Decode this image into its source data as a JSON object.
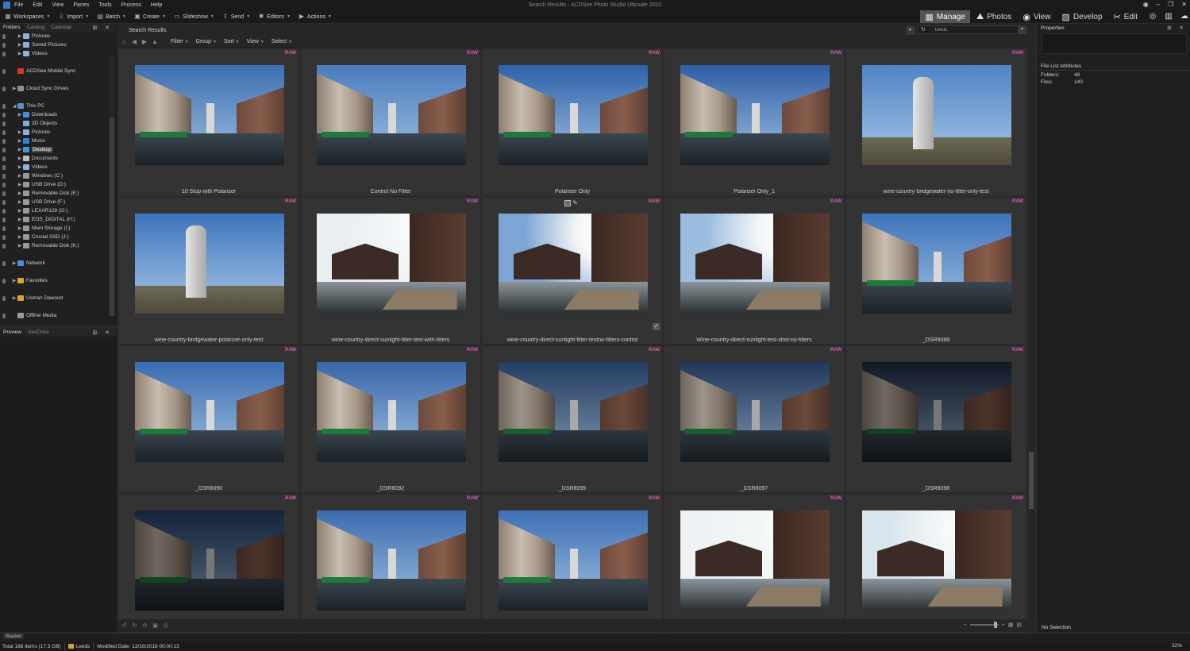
{
  "window": {
    "title": "Search Results - ACDSee Photo Studio Ultimate 2020"
  },
  "menu": [
    "File",
    "Edit",
    "View",
    "Panes",
    "Tools",
    "Process",
    "Help"
  ],
  "toolbar": [
    {
      "label": "Workspaces",
      "icon": "workspaces-icon",
      "glyph": "▦"
    },
    {
      "label": "Import",
      "icon": "import-icon",
      "glyph": "⇩"
    },
    {
      "label": "Batch",
      "icon": "batch-icon",
      "glyph": "▤"
    },
    {
      "label": "Create",
      "icon": "create-icon",
      "glyph": "▣"
    },
    {
      "label": "Slideshow",
      "icon": "slideshow-icon",
      "glyph": "▭"
    },
    {
      "label": "Send",
      "icon": "send-icon",
      "glyph": "⇪"
    },
    {
      "label": "Editors",
      "icon": "editors-icon",
      "glyph": "✱"
    },
    {
      "label": "Actions",
      "icon": "actions-icon",
      "glyph": "▶"
    }
  ],
  "modes": [
    {
      "label": "Manage",
      "icon": "manage-icon",
      "glyph": "▦",
      "active": true
    },
    {
      "label": "Photos",
      "icon": "photos-icon",
      "glyph": "⛰",
      "active": false
    },
    {
      "label": "View",
      "icon": "view-eye-icon",
      "glyph": "◉",
      "active": false
    },
    {
      "label": "Develop",
      "icon": "develop-icon",
      "glyph": "▨",
      "active": false
    },
    {
      "label": "Edit",
      "icon": "edit-icon",
      "glyph": "✂",
      "active": false
    }
  ],
  "mode_extras": [
    {
      "icon": "360-icon",
      "glyph": "◎"
    },
    {
      "icon": "dashboard-icon",
      "glyph": "▥"
    },
    {
      "icon": "online-icon",
      "glyph": "☁"
    }
  ],
  "left_tabs": [
    "Folders",
    "Catalog",
    "Calendar"
  ],
  "tree": [
    {
      "label": "Pictures",
      "indent": 2,
      "exp": "▶",
      "color": "#8fb0d8"
    },
    {
      "label": "Saved Pictures",
      "indent": 2,
      "exp": "▶",
      "color": "#8fb0d8"
    },
    {
      "label": "Videos",
      "indent": 2,
      "exp": "▶",
      "color": "#8fb0d8"
    },
    {
      "label": "",
      "gap": true
    },
    {
      "label": "ACDSee Mobile Sync",
      "indent": 1,
      "exp": "",
      "color": "#d23a2a"
    },
    {
      "label": "",
      "gap": true
    },
    {
      "label": "Cloud Sync Drives",
      "indent": 1,
      "exp": "▶",
      "color": "#8f8f8f"
    },
    {
      "label": "",
      "gap": true
    },
    {
      "label": "This PC",
      "indent": 1,
      "exp": "◢",
      "color": "#5b8fd0"
    },
    {
      "label": "Downloads",
      "indent": 2,
      "exp": "▶",
      "color": "#4a8de0"
    },
    {
      "label": "3D Objects",
      "indent": 2,
      "exp": "",
      "color": "#7ab0e0"
    },
    {
      "label": "Pictures",
      "indent": 2,
      "exp": "▶",
      "color": "#8fb0d8"
    },
    {
      "label": "Music",
      "indent": 2,
      "exp": "▶",
      "color": "#3a7fd0"
    },
    {
      "label": "Desktop",
      "indent": 2,
      "exp": "▶",
      "color": "#3a9ae0",
      "selected": true
    },
    {
      "label": "Documents",
      "indent": 2,
      "exp": "▶",
      "color": "#bfbfbf"
    },
    {
      "label": "Videos",
      "indent": 2,
      "exp": "▶",
      "color": "#8fb0d8"
    },
    {
      "label": "Windows (C:)",
      "indent": 2,
      "exp": "▶",
      "color": "#9a9a9a"
    },
    {
      "label": "USB Drive (D:)",
      "indent": 2,
      "exp": "▶",
      "color": "#9a9a9a"
    },
    {
      "label": "Removable Disk (E:)",
      "indent": 2,
      "exp": "▶",
      "color": "#9a9a9a"
    },
    {
      "label": "USB Drive (F:)",
      "indent": 2,
      "exp": "▶",
      "color": "#9a9a9a"
    },
    {
      "label": "LEXAR128 (G:)",
      "indent": 2,
      "exp": "▶",
      "color": "#9a9a9a"
    },
    {
      "label": "EOS_DIGITAL (H:)",
      "indent": 2,
      "exp": "▶",
      "color": "#9a9a9a"
    },
    {
      "label": "Main Storage (I:)",
      "indent": 2,
      "exp": "▶",
      "color": "#9a9a9a"
    },
    {
      "label": "Crucial SSD (J:)",
      "indent": 2,
      "exp": "▶",
      "color": "#9a9a9a"
    },
    {
      "label": "Removable Disk (K:)",
      "indent": 2,
      "exp": "▶",
      "color": "#9a9a9a"
    },
    {
      "label": "",
      "gap": true
    },
    {
      "label": "Network",
      "indent": 1,
      "exp": "▶",
      "color": "#4a8de0"
    },
    {
      "label": "",
      "gap": true
    },
    {
      "label": "Favorites",
      "indent": 1,
      "exp": "▶",
      "color": "#d9a62a"
    },
    {
      "label": "",
      "gap": true
    },
    {
      "label": "Usman Dawood",
      "indent": 1,
      "exp": "▶",
      "color": "#d9a62a"
    },
    {
      "label": "",
      "gap": true
    },
    {
      "label": "Offline Media",
      "indent": 1,
      "exp": "",
      "color": "#9a9a9a"
    }
  ],
  "preview_tabs": [
    "Preview",
    "SeeDrive"
  ],
  "pathbar": {
    "title": "Search Results"
  },
  "search": {
    "value": "leeds"
  },
  "filters": [
    "Filter",
    "Group",
    "Sort",
    "View",
    "Select"
  ],
  "thumbnails": [
    {
      "name": "10 Stop with Polariser",
      "scene": "canal",
      "sky": "#3d6fb0",
      "mood": "normal"
    },
    {
      "name": "Control No Filter",
      "scene": "canal",
      "sky": "#4b7cbd",
      "mood": "normal"
    },
    {
      "name": "Polariser Only",
      "scene": "canal",
      "sky": "#2f62ab",
      "mood": "normal"
    },
    {
      "name": "Polariser Only_1",
      "scene": "canal",
      "sky": "#2f5ea6",
      "mood": "normal"
    },
    {
      "name": "wine-country-bridgewater-no-filter-only-test",
      "scene": "tower",
      "sky": "#4d83c6",
      "mood": "normal"
    },
    {
      "name": "wine-country-bridgewater-polarizer-only-test",
      "scene": "tower",
      "sky": "#3c74bd",
      "mood": "normal"
    },
    {
      "name": "wine-country-direct-sunlight-filter-test-with-filters",
      "scene": "sun",
      "sky": "#e8eef2",
      "mood": "bright"
    },
    {
      "name": "wine-country-direct-sunlight-filter-testno-filters-control",
      "scene": "sun",
      "sky": "#7ea6d4",
      "mood": "bright",
      "selected": true
    },
    {
      "name": "Wine-country-direct-sunlight-test-shot-no-filters",
      "scene": "sun",
      "sky": "#9cbde0",
      "mood": "bright"
    },
    {
      "name": "_DSR8089",
      "scene": "canal",
      "sky": "#3f74bb",
      "mood": "normal"
    },
    {
      "name": "_DSR8090",
      "scene": "canal",
      "sky": "#3b6cb0",
      "mood": "normal"
    },
    {
      "name": "_DSR8092",
      "scene": "canal",
      "sky": "#3a66a8",
      "mood": "normal"
    },
    {
      "name": "_DSR8095",
      "scene": "canal",
      "sky": "#2f4f80",
      "mood": "dark"
    },
    {
      "name": "_DSR8097",
      "scene": "canal",
      "sky": "#2b4875",
      "mood": "dark"
    },
    {
      "name": "_DSR8098",
      "scene": "canal",
      "sky": "#1f2d45",
      "mood": "darker"
    },
    {
      "name": "",
      "scene": "canal",
      "sky": "#25406a",
      "mood": "darker"
    },
    {
      "name": "",
      "scene": "canal",
      "sky": "#3c6cb0",
      "mood": "normal"
    },
    {
      "name": "",
      "scene": "canal",
      "sky": "#3f70b5",
      "mood": "normal"
    },
    {
      "name": "",
      "scene": "sun",
      "sky": "#eef2f4",
      "mood": "bright"
    },
    {
      "name": "",
      "scene": "sun",
      "sky": "#d8e4ee",
      "mood": "bright"
    }
  ],
  "raw_badge": "RAW",
  "properties": {
    "title": "Properties",
    "section": "File List Attributes",
    "rows": [
      {
        "k": "Folders:",
        "v": "48"
      },
      {
        "k": "Files:",
        "v": "140"
      }
    ],
    "footer": "No Selection"
  },
  "basket": "Basket",
  "status": {
    "total": "Total 188 items  (17.3 GB)",
    "folder": "Leeds",
    "modified": "Modified Date: 13/10/2018 00:00:13",
    "zoom": "32%"
  }
}
